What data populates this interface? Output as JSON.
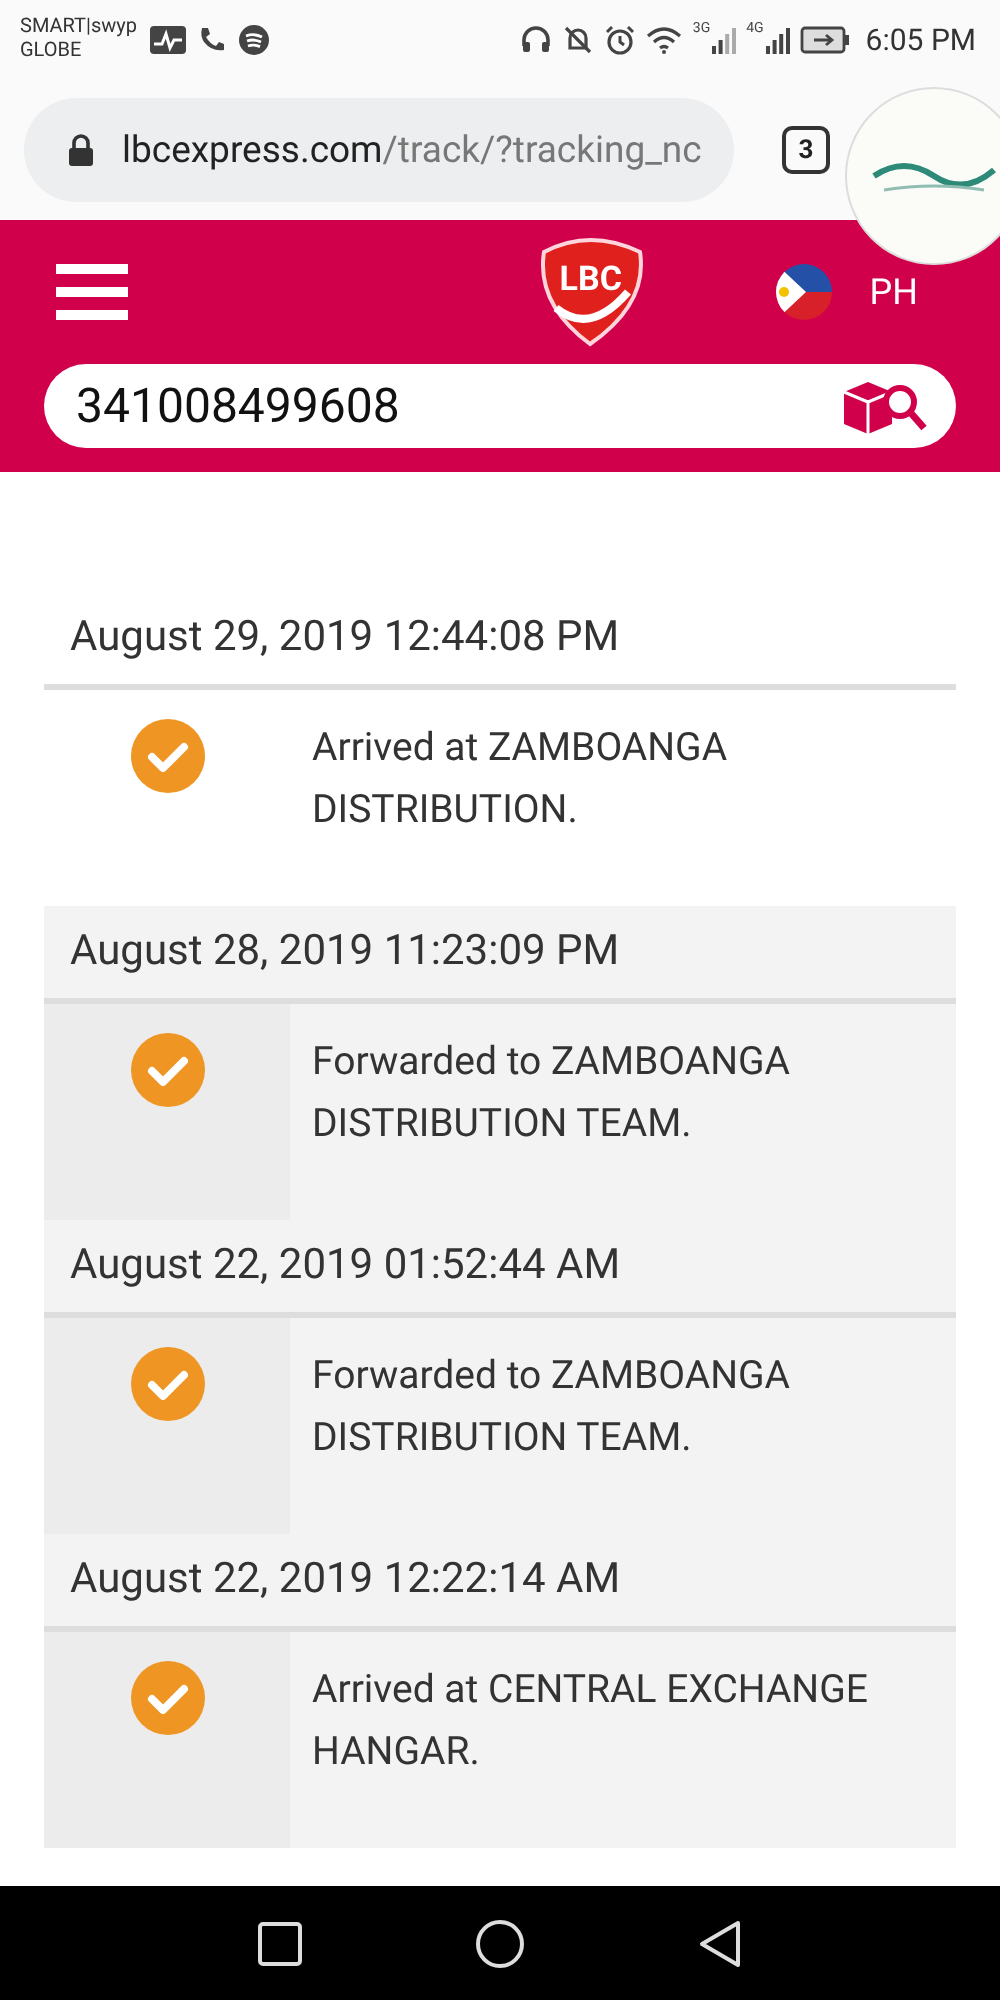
{
  "status_bar": {
    "carrier_1": "SMART|swyp",
    "carrier_2": "GLOBE",
    "network_1": "3G",
    "network_2": "4G",
    "time": "6:05 PM"
  },
  "browser": {
    "url_host": "lbcexpress.com",
    "url_path": "/track/?tracking_nc",
    "tab_count": "3"
  },
  "header": {
    "country": "PH",
    "logo_text": "LBC"
  },
  "search": {
    "value": "341008499608"
  },
  "events": [
    {
      "date": "August 29, 2019 12:44:08 PM",
      "status": "Arrived at ZAMBOANGA DISTRIBUTION.",
      "shaded": false
    },
    {
      "date": "August 28, 2019 11:23:09 PM",
      "status": "Forwarded to ZAMBOANGA DISTRIBUTION TEAM.",
      "shaded": true
    },
    {
      "date": "August 22, 2019 01:52:44 AM",
      "status": "Forwarded to ZAMBOANGA DISTRIBUTION TEAM.",
      "shaded": true
    },
    {
      "date": "August 22, 2019 12:22:14 AM",
      "status": "Arrived at CENTRAL EXCHANGE HANGAR.",
      "shaded": true
    }
  ]
}
